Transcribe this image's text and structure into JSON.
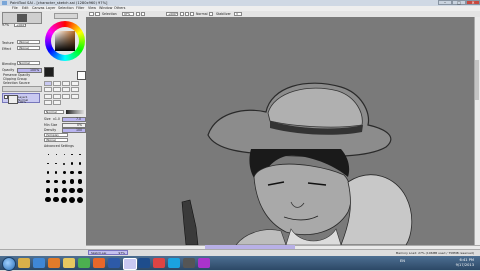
{
  "window": {
    "title": "PaintTool SAI - [character_sketch.sai (1280x960) 97%]",
    "minimize": "–",
    "maximize": "□",
    "close": "✕"
  },
  "menu": [
    "File",
    "Edit",
    "Canvas",
    "Layer",
    "Selection",
    "Filter",
    "View",
    "Window",
    "Others"
  ],
  "toolbar": {
    "selection_label": "Selection",
    "zoom_value": "97%",
    "rotate_value": "+000°",
    "mode_label": "Normal",
    "stabilizer_label": "Stabilizer",
    "stabilizer_value": "3"
  },
  "navigator": {
    "zoom": "97%",
    "angle": "+000°"
  },
  "color": {
    "ring_colors": [
      "#ff0000",
      "#ffff00",
      "#00ff00",
      "#00ffff",
      "#0000ff",
      "#ff00ff",
      "#ff0000"
    ],
    "square_hue": "#b86b2a"
  },
  "layer_panel": {
    "texture_label": "Texture",
    "texture_value": "(None)",
    "effect_label": "Effect",
    "effect_value": "(None)",
    "blend_label": "Blending",
    "blend_value": "Normal",
    "opacity_label": "Opacity",
    "opacity_value": "100%",
    "preserve_opacity": "Preserve Opacity",
    "clipping_group": "Clipping Group",
    "selection_source": "Selection Source",
    "layers": [
      {
        "name": "Layer1",
        "mode": "Normal",
        "opacity": "100%"
      }
    ]
  },
  "tools": [
    "Select",
    "Lasso",
    "Wand",
    "Move",
    "Zoom",
    "Rotate",
    "Hand",
    "Dropper",
    "Pen",
    "Airbrush",
    "Brush",
    "Water",
    "Eraser",
    "Marker"
  ],
  "brush_settings": {
    "mode": "Normal",
    "size_label": "Size",
    "size_value": "x1.0",
    "size_num": "7.0",
    "min_size_label": "Min Size",
    "min_size_value": "0%",
    "density_label": "Density",
    "density_value": "100",
    "shape_value": "(Simple)",
    "texture_value": "(None)",
    "advanced": "Advanced Settings",
    "size_presets": [
      "0.7",
      "0.8",
      "1",
      "1.5",
      "2",
      "2.3",
      "2.6",
      "3",
      "3.5",
      "4",
      "5",
      "6",
      "7",
      "8",
      "9",
      "10",
      "12",
      "14",
      "16",
      "20",
      "25",
      "30",
      "35",
      "40",
      "50",
      "60",
      "70",
      "80",
      "100",
      "120"
    ]
  },
  "status": {
    "doc_tab": "Sketch.sai",
    "doc_zoom": "97%",
    "memory": "Memory Load: 27% (106MB used / 758MB reserved)",
    "keys": "Shift Ctrl Alt SPC Any"
  },
  "taskbar": {
    "apps": [
      "explorer",
      "ie",
      "media",
      "folder",
      "chrome",
      "firefox",
      "word",
      "sai",
      "photoshop",
      "paint",
      "skype",
      "steam",
      "music"
    ],
    "time": "6:41 PM",
    "date": "9/17/2013",
    "lang": "EN"
  }
}
